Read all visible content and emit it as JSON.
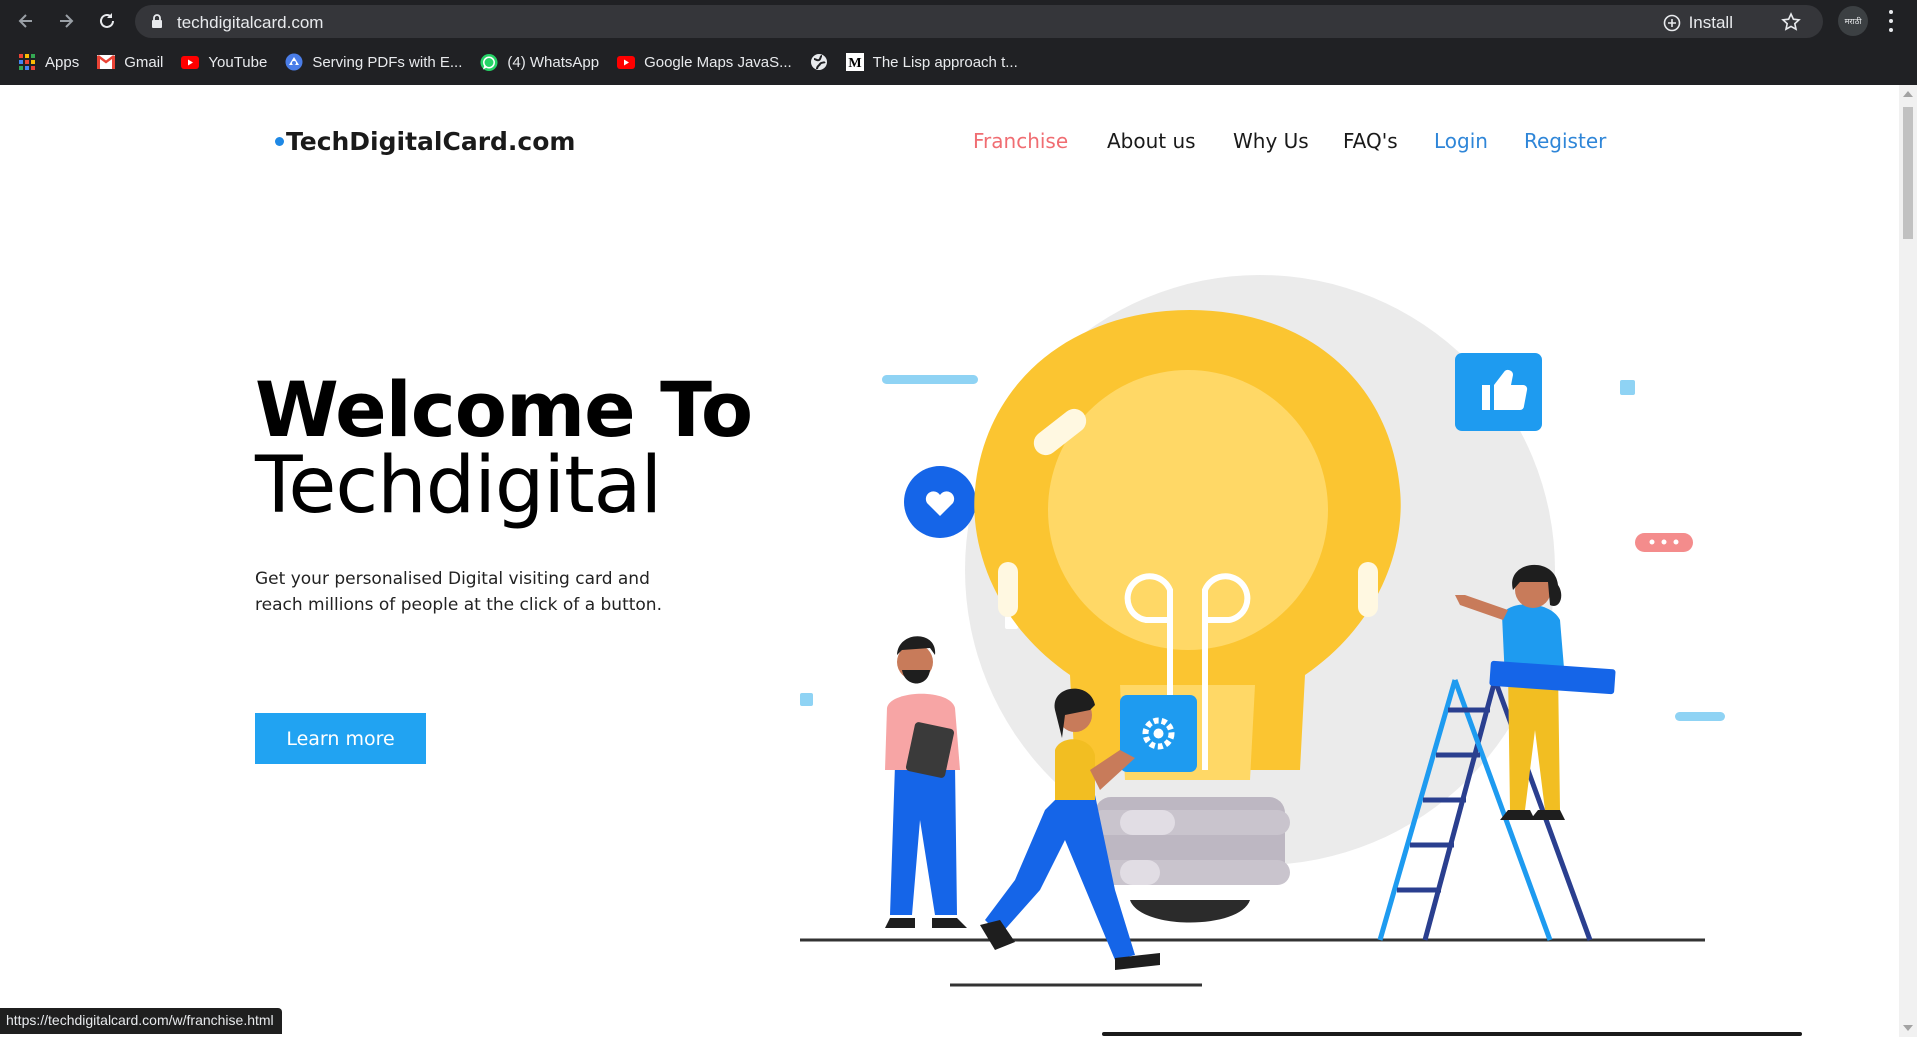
{
  "browser": {
    "url": "techdigitalcard.com",
    "install_label": "Install",
    "profile_text": "मराठी",
    "bookmarks": [
      {
        "label": "Apps",
        "icon": "apps-grid-icon"
      },
      {
        "label": "Gmail",
        "icon": "gmail-icon"
      },
      {
        "label": "YouTube",
        "icon": "youtube-icon"
      },
      {
        "label": "Serving PDFs with E...",
        "icon": "pdf-service-icon"
      },
      {
        "label": "(4) WhatsApp",
        "icon": "whatsapp-icon"
      },
      {
        "label": "Google Maps JavaS...",
        "icon": "youtube-icon"
      },
      {
        "label": "",
        "icon": "globe-icon"
      },
      {
        "label": "The Lisp approach t...",
        "icon": "medium-icon"
      }
    ],
    "status_url": "https://techdigitalcard.com/w/franchise.html"
  },
  "site": {
    "logo": "TechDigitalCard.com",
    "nav": [
      {
        "label": "Franchise",
        "color": "#f06d72"
      },
      {
        "label": "About us",
        "color": "#1a1a1a"
      },
      {
        "label": "Why Us",
        "color": "#1a1a1a"
      },
      {
        "label": "FAQ's",
        "color": "#1a1a1a"
      },
      {
        "label": "Login",
        "color": "#2f86d8"
      },
      {
        "label": "Register",
        "color": "#2f86d8"
      }
    ],
    "hero": {
      "title_line1": "Welcome To",
      "title_line2": "Techdigital",
      "subtitle": "Get your personalised Digital visiting card and reach millions of people at the click of a button.",
      "cta": "Learn more"
    }
  },
  "colors": {
    "accent_blue": "#21a3f2",
    "bulb_yellow": "#fbc531",
    "nav_active": "#f06d72",
    "link_blue": "#2f86d8"
  }
}
